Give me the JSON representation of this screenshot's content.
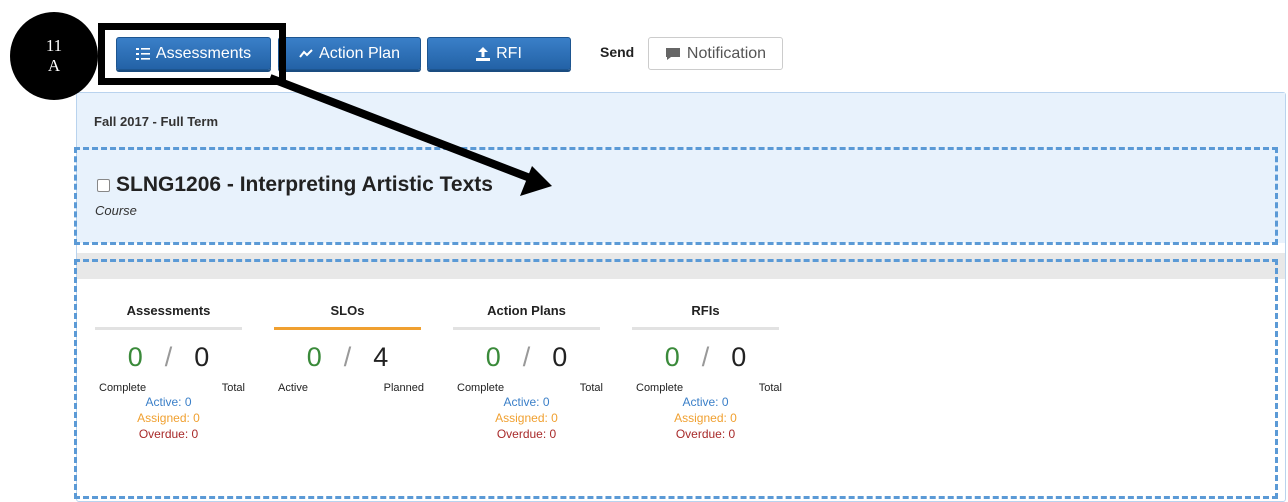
{
  "annotation": {
    "step_line1": "11",
    "step_line2": "A"
  },
  "toolbar": {
    "assessments_label": "Assessments",
    "action_plan_label": "Action Plan",
    "rfi_label": "RFI",
    "send_label": "Send",
    "notification_label": "Notification"
  },
  "panel": {
    "term": "Fall 2017 - Full Term",
    "course_title": "SLNG1206 - Interpreting Artistic Texts",
    "course_type": "Course"
  },
  "stats": [
    {
      "title": "Assessments",
      "left": "0",
      "right": "0",
      "left_label": "Complete",
      "right_label": "Total",
      "active": "Active: 0",
      "assigned": "Assigned: 0",
      "overdue": "Overdue: 0"
    },
    {
      "title": "SLOs",
      "left": "0",
      "right": "4",
      "left_label": "Active",
      "right_label": "Planned"
    },
    {
      "title": "Action Plans",
      "left": "0",
      "right": "0",
      "left_label": "Complete",
      "right_label": "Total",
      "active": "Active: 0",
      "assigned": "Assigned: 0",
      "overdue": "Overdue: 0"
    },
    {
      "title": "RFIs",
      "left": "0",
      "right": "0",
      "left_label": "Complete",
      "right_label": "Total",
      "active": "Active: 0",
      "assigned": "Assigned: 0",
      "overdue": "Overdue: 0"
    }
  ],
  "colors": {
    "primary": "#2a6db5",
    "green": "#3a8a3a",
    "orange": "#f0a030",
    "red": "#a82a2a",
    "highlight": "#5b9ad6"
  }
}
